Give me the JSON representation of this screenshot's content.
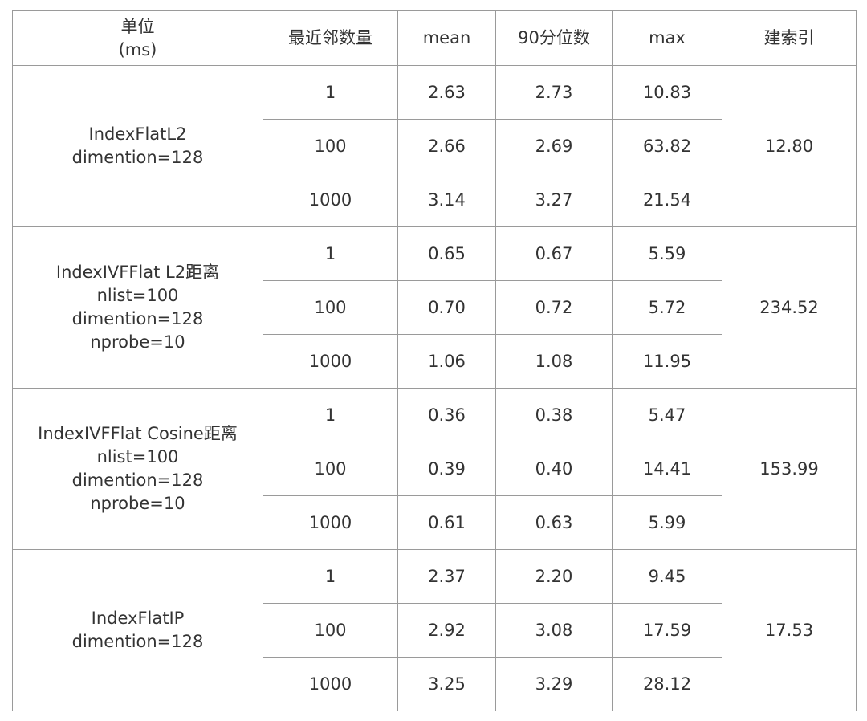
{
  "table": {
    "headers": [
      [
        "单位",
        "(ms)"
      ],
      [
        "最近邻数量"
      ],
      [
        "mean"
      ],
      [
        "90分位数"
      ],
      [
        "max"
      ],
      [
        "建索引"
      ]
    ],
    "groups": [
      {
        "index_lines": [
          "IndexFlatL2",
          "dimention=128"
        ],
        "build_time": "12.80",
        "rows": [
          {
            "k": "1",
            "mean": "2.63",
            "p90": "2.73",
            "max": "10.83"
          },
          {
            "k": "100",
            "mean": "2.66",
            "p90": "2.69",
            "max": "63.82"
          },
          {
            "k": "1000",
            "mean": "3.14",
            "p90": "3.27",
            "max": "21.54"
          }
        ]
      },
      {
        "index_lines": [
          "IndexIVFFlat L2距离",
          "nlist=100",
          "dimention=128",
          "nprobe=10"
        ],
        "build_time": "234.52",
        "rows": [
          {
            "k": "1",
            "mean": "0.65",
            "p90": "0.67",
            "max": "5.59"
          },
          {
            "k": "100",
            "mean": "0.70",
            "p90": "0.72",
            "max": "5.72"
          },
          {
            "k": "1000",
            "mean": "1.06",
            "p90": "1.08",
            "max": "11.95"
          }
        ]
      },
      {
        "index_lines": [
          "IndexIVFFlat Cosine距离",
          "nlist=100",
          "dimention=128",
          "nprobe=10"
        ],
        "build_time": "153.99",
        "rows": [
          {
            "k": "1",
            "mean": "0.36",
            "p90": "0.38",
            "max": "5.47"
          },
          {
            "k": "100",
            "mean": "0.39",
            "p90": "0.40",
            "max": "14.41"
          },
          {
            "k": "1000",
            "mean": "0.61",
            "p90": "0.63",
            "max": "5.99"
          }
        ]
      },
      {
        "index_lines": [
          "IndexFlatIP",
          "dimention=128"
        ],
        "build_time": "17.53",
        "rows": [
          {
            "k": "1",
            "mean": "2.37",
            "p90": "2.20",
            "max": "9.45"
          },
          {
            "k": "100",
            "mean": "2.92",
            "p90": "3.08",
            "max": "17.59"
          },
          {
            "k": "1000",
            "mean": "3.25",
            "p90": "3.29",
            "max": "28.12"
          }
        ]
      }
    ]
  }
}
